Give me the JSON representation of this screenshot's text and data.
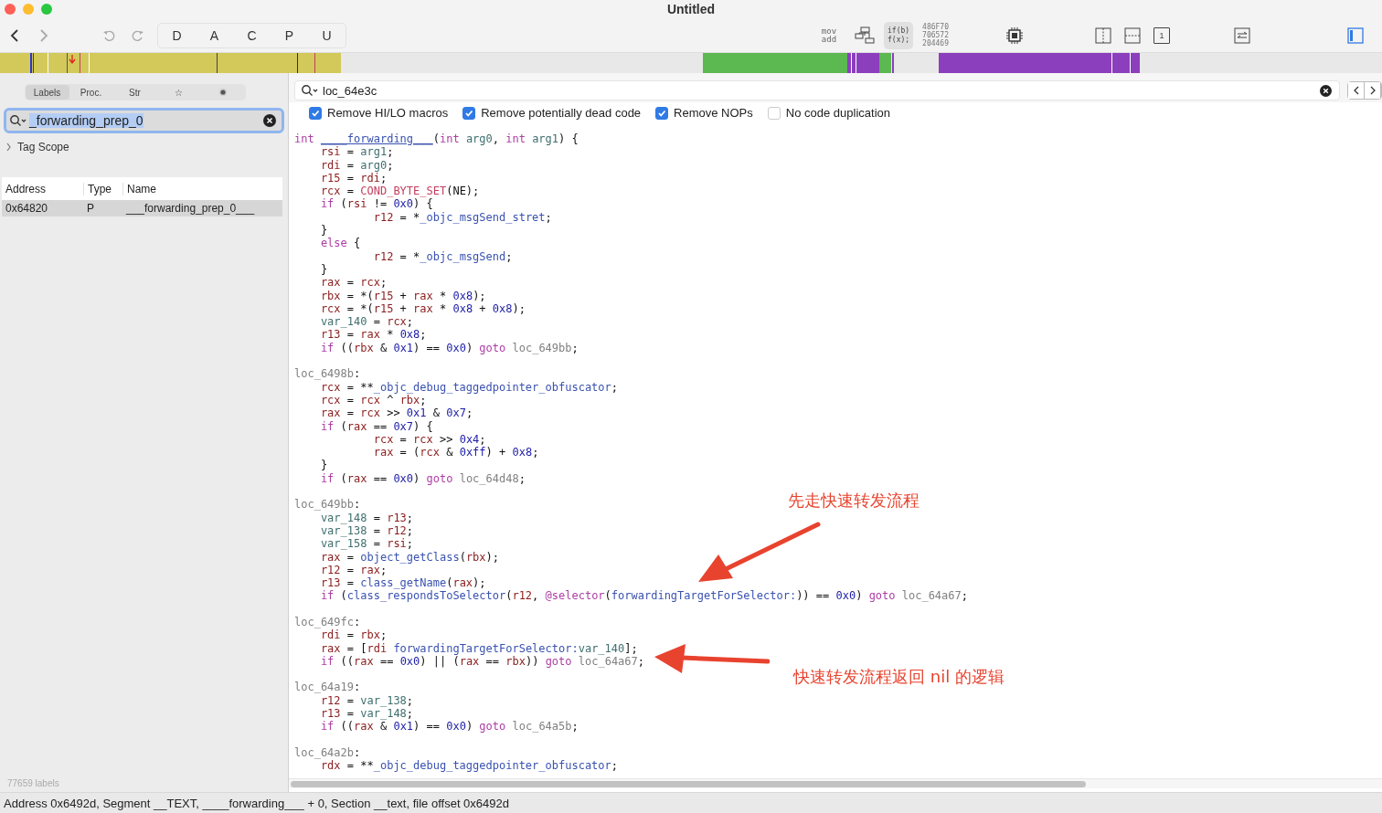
{
  "window": {
    "title": "Untitled"
  },
  "toolbar": {
    "edit_buttons": [
      "D",
      "A",
      "C",
      "P",
      "U"
    ],
    "modes": [
      {
        "kind": "asm",
        "lines": [
          "mov",
          "add"
        ],
        "selected": false
      },
      {
        "kind": "graph",
        "selected": false
      },
      {
        "kind": "pseudo",
        "lines": [
          "if(b)",
          "f(x);"
        ],
        "selected": true
      },
      {
        "kind": "hex",
        "lines": [
          "486F70",
          "706572",
          "204469"
        ],
        "selected": false
      }
    ],
    "view_buttons": [
      {
        "kind": "vsplit"
      },
      {
        "kind": "hsplit"
      },
      {
        "kind": "page",
        "label": "1"
      }
    ],
    "sidebar_toggle": {
      "selected": true
    }
  },
  "sidebar": {
    "tabs": [
      {
        "kind": "text",
        "label": "Labels",
        "selected": true
      },
      {
        "kind": "text",
        "label": "Proc.",
        "selected": false
      },
      {
        "kind": "text",
        "label": "Str",
        "selected": false
      },
      {
        "kind": "text",
        "label": "☆",
        "selected": false
      },
      {
        "kind": "dot",
        "selected": false
      }
    ],
    "search": {
      "value": "_forwarding_prep_0"
    },
    "tag_scope": {
      "label": "Tag Scope",
      "expanded": false
    },
    "table": {
      "columns": [
        "Address",
        "Type",
        "Name"
      ],
      "rows": [
        {
          "cells": [
            "0x64820",
            "P",
            "___forwarding_prep_0___"
          ],
          "selected": true
        }
      ]
    },
    "footer": "77659 labels"
  },
  "editor": {
    "search": {
      "value": "loc_64e3c"
    },
    "options": [
      {
        "label": "Remove HI/LO macros",
        "checked": true
      },
      {
        "label": "Remove potentially dead code",
        "checked": true
      },
      {
        "label": "Remove NOPs",
        "checked": true
      },
      {
        "label": "No code duplication",
        "checked": false
      }
    ],
    "blocks": [
      {
        "head": [
          {
            "kind": "k",
            "text": "int"
          },
          {
            "kind": "f",
            "text": "____forwarding___",
            "space_before": true
          },
          {
            "kind": "p",
            "text": "("
          },
          {
            "kind": "k",
            "text": "int"
          },
          {
            "kind": "v",
            "text": "arg0",
            "space_before": true
          },
          {
            "kind": "p",
            "text": ", "
          },
          {
            "kind": "k",
            "text": "int"
          },
          {
            "kind": "v",
            "text": "arg1",
            "space_before": true
          },
          {
            "kind": "p",
            "text": ") {"
          }
        ],
        "lines": [
          {
            "tokens": [
              {
                "kind": "r",
                "text": "rsi"
              },
              {
                "kind": "p",
                "text": " = "
              },
              {
                "kind": "v",
                "text": "arg1"
              },
              {
                "kind": "p",
                "text": ";"
              }
            ]
          },
          {
            "tokens": [
              {
                "kind": "r",
                "text": "rdi"
              },
              {
                "kind": "p",
                "text": " = "
              },
              {
                "kind": "v",
                "text": "arg0"
              },
              {
                "kind": "p",
                "text": ";"
              }
            ]
          },
          {
            "tokens": [
              {
                "kind": "r",
                "text": "r15"
              },
              {
                "kind": "p",
                "text": " = "
              },
              {
                "kind": "r",
                "text": "rdi"
              },
              {
                "kind": "p",
                "text": ";"
              }
            ]
          },
          {
            "tokens": [
              {
                "kind": "r",
                "text": "rcx"
              },
              {
                "kind": "p",
                "text": " = "
              },
              {
                "kind": "m",
                "text": "COND_BYTE_SET"
              },
              {
                "kind": "p",
                "text": "(NE);"
              }
            ]
          },
          {
            "tokens": [
              {
                "kind": "k",
                "text": "if"
              },
              {
                "kind": "p",
                "text": " ("
              },
              {
                "kind": "r",
                "text": "rsi"
              },
              {
                "kind": "p",
                "text": " != "
              },
              {
                "kind": "n",
                "text": "0x0"
              },
              {
                "kind": "p",
                "text": ") {"
              }
            ],
            "children": [
              {
                "tokens": [
                  {
                    "kind": "r",
                    "text": "r12"
                  },
                  {
                    "kind": "p",
                    "text": " = *"
                  },
                  {
                    "kind": "f",
                    "text": "_objc_msgSend_stret"
                  },
                  {
                    "kind": "p",
                    "text": ";"
                  }
                ]
              }
            ]
          },
          {
            "tokens": [
              {
                "kind": "p",
                "text": "}"
              }
            ]
          },
          {
            "tokens": [
              {
                "kind": "k",
                "text": "else"
              },
              {
                "kind": "p",
                "text": " {"
              }
            ],
            "children": [
              {
                "tokens": [
                  {
                    "kind": "r",
                    "text": "r12"
                  },
                  {
                    "kind": "p",
                    "text": " = *"
                  },
                  {
                    "kind": "f",
                    "text": "_objc_msgSend"
                  },
                  {
                    "kind": "p",
                    "text": ";"
                  }
                ]
              }
            ]
          },
          {
            "tokens": [
              {
                "kind": "p",
                "text": "}"
              }
            ]
          },
          {
            "tokens": [
              {
                "kind": "r",
                "text": "rax"
              },
              {
                "kind": "p",
                "text": " = "
              },
              {
                "kind": "r",
                "text": "rcx"
              },
              {
                "kind": "p",
                "text": ";"
              }
            ]
          },
          {
            "tokens": [
              {
                "kind": "r",
                "text": "rbx"
              },
              {
                "kind": "p",
                "text": " = *("
              },
              {
                "kind": "r",
                "text": "r15"
              },
              {
                "kind": "p",
                "text": " + "
              },
              {
                "kind": "r",
                "text": "rax"
              },
              {
                "kind": "p",
                "text": " * "
              },
              {
                "kind": "n",
                "text": "0x8"
              },
              {
                "kind": "p",
                "text": ");"
              }
            ]
          },
          {
            "tokens": [
              {
                "kind": "r",
                "text": "rcx"
              },
              {
                "kind": "p",
                "text": " = *("
              },
              {
                "kind": "r",
                "text": "r15"
              },
              {
                "kind": "p",
                "text": " + "
              },
              {
                "kind": "r",
                "text": "rax"
              },
              {
                "kind": "p",
                "text": " * "
              },
              {
                "kind": "n",
                "text": "0x8"
              },
              {
                "kind": "p",
                "text": " + "
              },
              {
                "kind": "n",
                "text": "0x8"
              },
              {
                "kind": "p",
                "text": ");"
              }
            ]
          },
          {
            "tokens": [
              {
                "kind": "v",
                "text": "var_140"
              },
              {
                "kind": "p",
                "text": " = "
              },
              {
                "kind": "r",
                "text": "rcx"
              },
              {
                "kind": "p",
                "text": ";"
              }
            ]
          },
          {
            "tokens": [
              {
                "kind": "r",
                "text": "r13"
              },
              {
                "kind": "p",
                "text": " = "
              },
              {
                "kind": "r",
                "text": "rax"
              },
              {
                "kind": "p",
                "text": " * "
              },
              {
                "kind": "n",
                "text": "0x8"
              },
              {
                "kind": "p",
                "text": ";"
              }
            ]
          },
          {
            "tokens": [
              {
                "kind": "k",
                "text": "if"
              },
              {
                "kind": "p",
                "text": " (("
              },
              {
                "kind": "r",
                "text": "rbx"
              },
              {
                "kind": "p",
                "text": " & "
              },
              {
                "kind": "n",
                "text": "0x1"
              },
              {
                "kind": "p",
                "text": ") == "
              },
              {
                "kind": "n",
                "text": "0x0"
              },
              {
                "kind": "p",
                "text": ") "
              },
              {
                "kind": "k",
                "text": "goto"
              },
              {
                "kind": "l",
                "text": "loc_649bb",
                "space_before": true
              },
              {
                "kind": "p",
                "text": ";"
              }
            ]
          }
        ]
      },
      {
        "head": [
          {
            "kind": "l",
            "text": "loc_6498b"
          },
          {
            "kind": "p",
            "text": ":"
          }
        ],
        "lines": [
          {
            "tokens": [
              {
                "kind": "r",
                "text": "rcx"
              },
              {
                "kind": "p",
                "text": " = **"
              },
              {
                "kind": "f",
                "text": "_objc_debug_taggedpointer_obfuscator"
              },
              {
                "kind": "p",
                "text": ";"
              }
            ]
          },
          {
            "tokens": [
              {
                "kind": "r",
                "text": "rcx"
              },
              {
                "kind": "p",
                "text": " = "
              },
              {
                "kind": "r",
                "text": "rcx"
              },
              {
                "kind": "p",
                "text": " ^ "
              },
              {
                "kind": "r",
                "text": "rbx"
              },
              {
                "kind": "p",
                "text": ";"
              }
            ]
          },
          {
            "tokens": [
              {
                "kind": "r",
                "text": "rax"
              },
              {
                "kind": "p",
                "text": " = "
              },
              {
                "kind": "r",
                "text": "rcx"
              },
              {
                "kind": "p",
                "text": " >> "
              },
              {
                "kind": "n",
                "text": "0x1"
              },
              {
                "kind": "p",
                "text": " & "
              },
              {
                "kind": "n",
                "text": "0x7"
              },
              {
                "kind": "p",
                "text": ";"
              }
            ]
          },
          {
            "tokens": [
              {
                "kind": "k",
                "text": "if"
              },
              {
                "kind": "p",
                "text": " ("
              },
              {
                "kind": "r",
                "text": "rax"
              },
              {
                "kind": "p",
                "text": " == "
              },
              {
                "kind": "n",
                "text": "0x7"
              },
              {
                "kind": "p",
                "text": ") {"
              }
            ],
            "children": [
              {
                "tokens": [
                  {
                    "kind": "r",
                    "text": "rcx"
                  },
                  {
                    "kind": "p",
                    "text": " = "
                  },
                  {
                    "kind": "r",
                    "text": "rcx"
                  },
                  {
                    "kind": "p",
                    "text": " >> "
                  },
                  {
                    "kind": "n",
                    "text": "0x4"
                  },
                  {
                    "kind": "p",
                    "text": ";"
                  }
                ]
              },
              {
                "tokens": [
                  {
                    "kind": "r",
                    "text": "rax"
                  },
                  {
                    "kind": "p",
                    "text": " = ("
                  },
                  {
                    "kind": "r",
                    "text": "rcx"
                  },
                  {
                    "kind": "p",
                    "text": " & "
                  },
                  {
                    "kind": "n",
                    "text": "0xff"
                  },
                  {
                    "kind": "p",
                    "text": ") + "
                  },
                  {
                    "kind": "n",
                    "text": "0x8"
                  },
                  {
                    "kind": "p",
                    "text": ";"
                  }
                ]
              }
            ]
          },
          {
            "tokens": [
              {
                "kind": "p",
                "text": "}"
              }
            ]
          },
          {
            "tokens": [
              {
                "kind": "k",
                "text": "if"
              },
              {
                "kind": "p",
                "text": " ("
              },
              {
                "kind": "r",
                "text": "rax"
              },
              {
                "kind": "p",
                "text": " == "
              },
              {
                "kind": "n",
                "text": "0x0"
              },
              {
                "kind": "p",
                "text": ") "
              },
              {
                "kind": "k",
                "text": "goto"
              },
              {
                "kind": "l",
                "text": "loc_64d48",
                "space_before": true
              },
              {
                "kind": "p",
                "text": ";"
              }
            ]
          }
        ]
      },
      {
        "head": [
          {
            "kind": "l",
            "text": "loc_649bb"
          },
          {
            "kind": "p",
            "text": ":"
          }
        ],
        "lines": [
          {
            "tokens": [
              {
                "kind": "v",
                "text": "var_148"
              },
              {
                "kind": "p",
                "text": " = "
              },
              {
                "kind": "r",
                "text": "r13"
              },
              {
                "kind": "p",
                "text": ";"
              }
            ]
          },
          {
            "tokens": [
              {
                "kind": "v",
                "text": "var_138"
              },
              {
                "kind": "p",
                "text": " = "
              },
              {
                "kind": "r",
                "text": "r12"
              },
              {
                "kind": "p",
                "text": ";"
              }
            ]
          },
          {
            "tokens": [
              {
                "kind": "v",
                "text": "var_158"
              },
              {
                "kind": "p",
                "text": " = "
              },
              {
                "kind": "r",
                "text": "rsi"
              },
              {
                "kind": "p",
                "text": ";"
              }
            ]
          },
          {
            "tokens": [
              {
                "kind": "r",
                "text": "rax"
              },
              {
                "kind": "p",
                "text": " = "
              },
              {
                "kind": "f",
                "text": "object_getClass"
              },
              {
                "kind": "p",
                "text": "("
              },
              {
                "kind": "r",
                "text": "rbx"
              },
              {
                "kind": "p",
                "text": ");"
              }
            ]
          },
          {
            "tokens": [
              {
                "kind": "r",
                "text": "r12"
              },
              {
                "kind": "p",
                "text": " = "
              },
              {
                "kind": "r",
                "text": "rax"
              },
              {
                "kind": "p",
                "text": ";"
              }
            ]
          },
          {
            "tokens": [
              {
                "kind": "r",
                "text": "r13"
              },
              {
                "kind": "p",
                "text": " = "
              },
              {
                "kind": "f",
                "text": "class_getName"
              },
              {
                "kind": "p",
                "text": "("
              },
              {
                "kind": "r",
                "text": "rax"
              },
              {
                "kind": "p",
                "text": ");"
              }
            ]
          },
          {
            "tokens": [
              {
                "kind": "k",
                "text": "if"
              },
              {
                "kind": "p",
                "text": " ("
              },
              {
                "kind": "f",
                "text": "class_respondsToSelector"
              },
              {
                "kind": "p",
                "text": "("
              },
              {
                "kind": "r",
                "text": "r12"
              },
              {
                "kind": "p",
                "text": ", "
              },
              {
                "kind": "k",
                "text": "@selector"
              },
              {
                "kind": "p",
                "text": "("
              },
              {
                "kind": "f",
                "text": "forwardingTargetForSelector:"
              },
              {
                "kind": "p",
                "text": ")) == "
              },
              {
                "kind": "n",
                "text": "0x0"
              },
              {
                "kind": "p",
                "text": ") "
              },
              {
                "kind": "k",
                "text": "goto"
              },
              {
                "kind": "l",
                "text": "loc_64a67",
                "space_before": true
              },
              {
                "kind": "p",
                "text": ";"
              }
            ]
          }
        ]
      },
      {
        "head": [
          {
            "kind": "l",
            "text": "loc_649fc"
          },
          {
            "kind": "p",
            "text": ":"
          }
        ],
        "lines": [
          {
            "tokens": [
              {
                "kind": "r",
                "text": "rdi"
              },
              {
                "kind": "p",
                "text": " = "
              },
              {
                "kind": "r",
                "text": "rbx"
              },
              {
                "kind": "p",
                "text": ";"
              }
            ]
          },
          {
            "tokens": [
              {
                "kind": "r",
                "text": "rax"
              },
              {
                "kind": "p",
                "text": " = ["
              },
              {
                "kind": "r",
                "text": "rdi"
              },
              {
                "kind": "f",
                "text": "forwardingTargetForSelector:",
                "space_before": true
              },
              {
                "kind": "v",
                "text": "var_140"
              },
              {
                "kind": "p",
                "text": "];"
              }
            ]
          },
          {
            "tokens": [
              {
                "kind": "k",
                "text": "if"
              },
              {
                "kind": "p",
                "text": " (("
              },
              {
                "kind": "r",
                "text": "rax"
              },
              {
                "kind": "p",
                "text": " == "
              },
              {
                "kind": "n",
                "text": "0x0"
              },
              {
                "kind": "p",
                "text": ") || ("
              },
              {
                "kind": "r",
                "text": "rax"
              },
              {
                "kind": "p",
                "text": " == "
              },
              {
                "kind": "r",
                "text": "rbx"
              },
              {
                "kind": "p",
                "text": ")) "
              },
              {
                "kind": "k",
                "text": "goto"
              },
              {
                "kind": "l",
                "text": "loc_64a67",
                "space_before": true
              },
              {
                "kind": "p",
                "text": ";"
              }
            ]
          }
        ]
      },
      {
        "head": [
          {
            "kind": "l",
            "text": "loc_64a19"
          },
          {
            "kind": "p",
            "text": ":"
          }
        ],
        "lines": [
          {
            "tokens": [
              {
                "kind": "r",
                "text": "r12"
              },
              {
                "kind": "p",
                "text": " = "
              },
              {
                "kind": "v",
                "text": "var_138"
              },
              {
                "kind": "p",
                "text": ";"
              }
            ]
          },
          {
            "tokens": [
              {
                "kind": "r",
                "text": "r13"
              },
              {
                "kind": "p",
                "text": " = "
              },
              {
                "kind": "v",
                "text": "var_148"
              },
              {
                "kind": "p",
                "text": ";"
              }
            ]
          },
          {
            "tokens": [
              {
                "kind": "k",
                "text": "if"
              },
              {
                "kind": "p",
                "text": " (("
              },
              {
                "kind": "r",
                "text": "rax"
              },
              {
                "kind": "p",
                "text": " & "
              },
              {
                "kind": "n",
                "text": "0x1"
              },
              {
                "kind": "p",
                "text": ") == "
              },
              {
                "kind": "n",
                "text": "0x0"
              },
              {
                "kind": "p",
                "text": ") "
              },
              {
                "kind": "k",
                "text": "goto"
              },
              {
                "kind": "l",
                "text": "loc_64a5b",
                "space_before": true
              },
              {
                "kind": "p",
                "text": ";"
              }
            ]
          }
        ]
      },
      {
        "head": [
          {
            "kind": "l",
            "text": "loc_64a2b"
          },
          {
            "kind": "p",
            "text": ":"
          }
        ],
        "lines": [
          {
            "tokens": [
              {
                "kind": "r",
                "text": "rdx"
              },
              {
                "kind": "p",
                "text": " = **"
              },
              {
                "kind": "f",
                "text": "_objc_debug_taggedpointer_obfuscator"
              },
              {
                "kind": "p",
                "text": ";"
              }
            ]
          }
        ]
      }
    ],
    "annotations": [
      {
        "kind": "diagonal",
        "text": "先走快速转发流程"
      },
      {
        "kind": "horizontal",
        "text": "快速转发流程返回 nil 的逻辑"
      }
    ]
  },
  "status_bar": "Address 0x6492d, Segment __TEXT, ____forwarding___ + 0, Section __text, file offset 0x6492d"
}
